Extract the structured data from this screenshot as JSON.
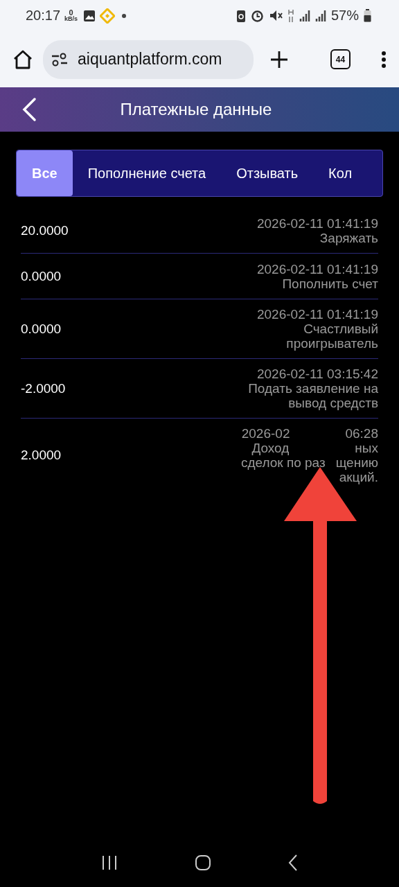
{
  "status_bar": {
    "time": "20:17",
    "speed_value": "0",
    "speed_unit": "kB/s",
    "battery": "57%"
  },
  "browser": {
    "url": "aiquantplatform.com",
    "tab_count": "44"
  },
  "header": {
    "title": "Платежные данные"
  },
  "tabs": [
    {
      "label": "Все",
      "selected": true
    },
    {
      "label": "Пополнение счета",
      "selected": false
    },
    {
      "label": "Отзывать",
      "selected": false
    },
    {
      "label": "Кол",
      "selected": false
    }
  ],
  "records": [
    {
      "amount": "20.0000",
      "lines": [
        [
          "2026-02-11 01:41:19"
        ],
        [
          "Заряжать"
        ]
      ]
    },
    {
      "amount": "0.0000",
      "lines": [
        [
          "2026-02-11 01:41:19"
        ],
        [
          "Пополнить счет"
        ]
      ]
    },
    {
      "amount": "0.0000",
      "lines": [
        [
          "2026-02-11 01:41:19"
        ],
        [
          "Счастливый"
        ],
        [
          "проигрыватель"
        ]
      ]
    },
    {
      "amount": "-2.0000",
      "lines": [
        [
          "2026-02-11 03:15:42"
        ],
        [
          "Подать заявление на"
        ],
        [
          "вывод средств"
        ]
      ]
    },
    {
      "amount": "2.0000",
      "lines": [
        [
          "2026-02",
          "06:28"
        ],
        [
          "Доход",
          "ных"
        ],
        [
          "сделок по раз",
          "щению"
        ],
        [
          "акций."
        ]
      ]
    }
  ]
}
